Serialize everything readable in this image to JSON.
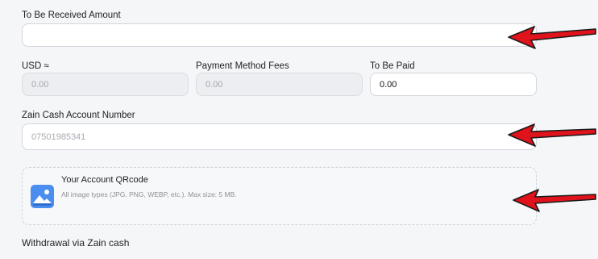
{
  "form": {
    "receive_amount": {
      "label": "To Be Received Amount",
      "value": ""
    },
    "usd": {
      "label": "USD ≈",
      "value": "0.00"
    },
    "fees": {
      "label": "Payment Method Fees",
      "value": "0.00"
    },
    "to_be_paid": {
      "label": "To Be Paid",
      "value": "0.00"
    },
    "account_number": {
      "label": "Zain Cash Account Number",
      "placeholder": "07501985341"
    },
    "qrcode": {
      "title": "Your Account QRcode",
      "hint": "All image types (JPG, PNG, WEBP, etc.). Max size: 5 MB."
    },
    "section_title": "Withdrawal via Zain cash"
  },
  "colors": {
    "arrow_red": "#e0121b",
    "icon_blue": "#4b8ef0",
    "background": "#f5f6f8"
  },
  "icons": [
    "image-upload-icon",
    "annotation-arrow-icon"
  ]
}
